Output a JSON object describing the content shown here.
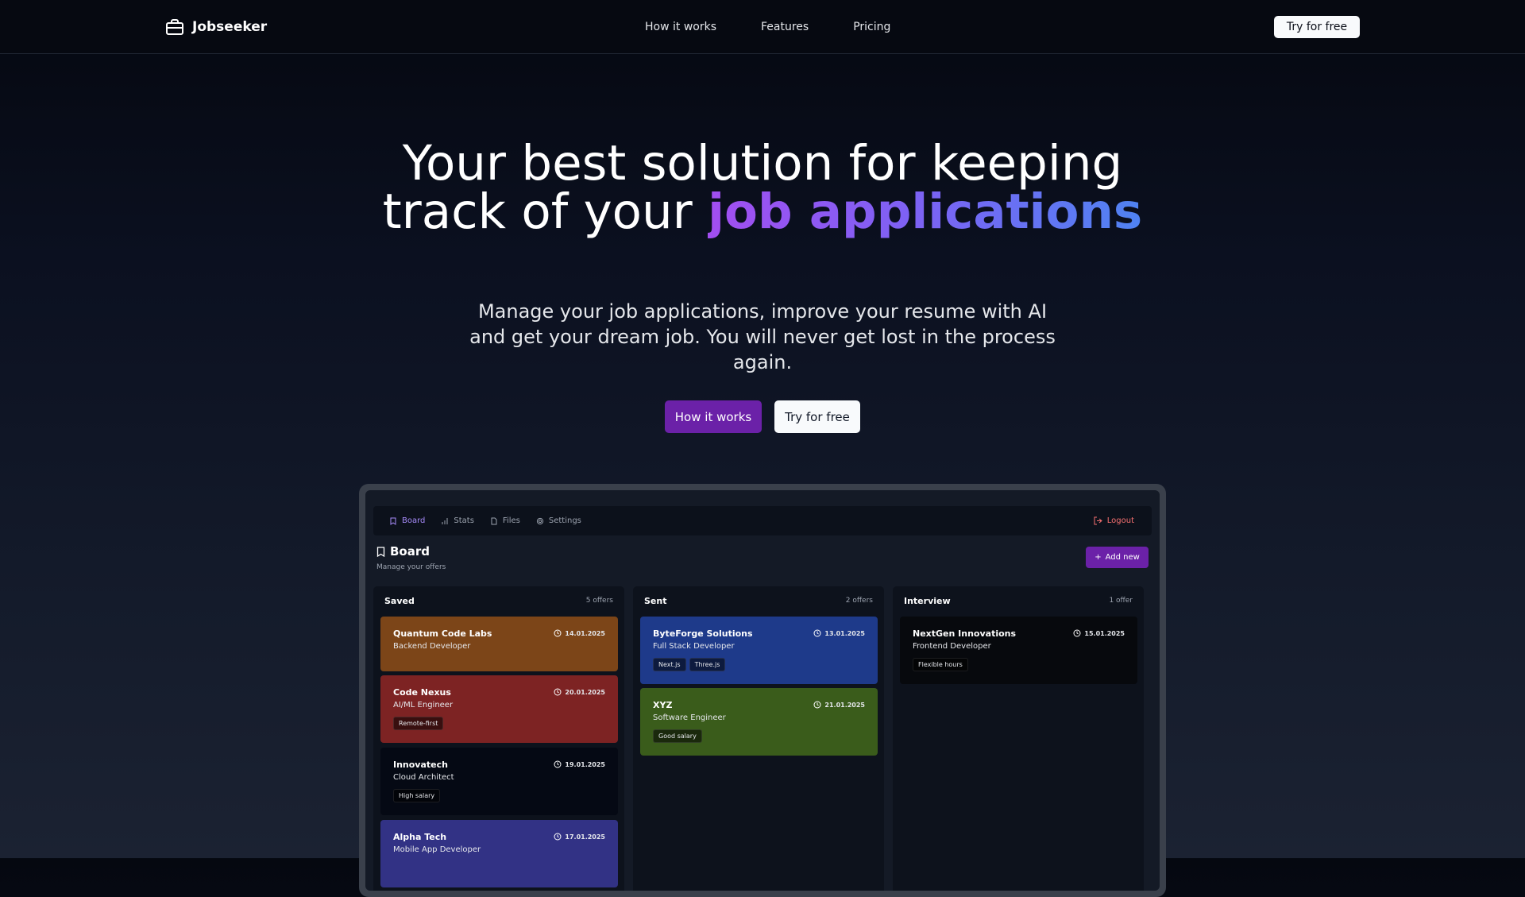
{
  "nav": {
    "brand": "Jobseeker",
    "links": [
      "How it works",
      "Features",
      "Pricing"
    ],
    "cta": "Try for free"
  },
  "hero": {
    "title_plain": "Your best solution for keeping track of your",
    "title_highlight": "job applications",
    "subtitle": "Manage your job applications, improve your resume with AI and get your dream job. You will never get lost in the process again.",
    "primary_button": "How it works",
    "secondary_button": "Try for free"
  },
  "app": {
    "tabs": [
      "Board",
      "Stats",
      "Files",
      "Settings"
    ],
    "active_tab": "Board",
    "logout": "Logout",
    "board_title": "Board",
    "board_subtitle": "Manage your offers",
    "add_new": "Add new",
    "columns": [
      {
        "title": "Saved",
        "count": "5 offers",
        "cards": [
          {
            "company": "Quantum Code Labs",
            "role": "Backend Developer",
            "date": "14.01.2025",
            "tags": [],
            "color": "#7c4518"
          },
          {
            "company": "Code Nexus",
            "role": "AI/ML Engineer",
            "date": "20.01.2025",
            "tags": [
              "Remote-first"
            ],
            "color": "#7d2323"
          },
          {
            "company": "Innovatech",
            "role": "Cloud Architect",
            "date": "19.01.2025",
            "tags": [
              "High salary"
            ],
            "color": "#050914"
          },
          {
            "company": "Alpha Tech",
            "role": "Mobile App Developer",
            "date": "17.01.2025",
            "tags": [],
            "color": "#323285"
          }
        ]
      },
      {
        "title": "Sent",
        "count": "2 offers",
        "cards": [
          {
            "company": "ByteForge Solutions",
            "role": "Full Stack Developer",
            "date": "13.01.2025",
            "tags": [
              "Next.js",
              "Three.js"
            ],
            "color": "#1e3a8a"
          },
          {
            "company": "XYZ",
            "role": "Software Engineer",
            "date": "21.01.2025",
            "tags": [
              "Good salary"
            ],
            "color": "#3a5c1b"
          }
        ]
      },
      {
        "title": "Interview",
        "count": "1 offer",
        "cards": [
          {
            "company": "NextGen Innovations",
            "role": "Frontend Developer",
            "date": "15.01.2025",
            "tags": [
              "Flexible hours"
            ],
            "color": "#07090d"
          }
        ]
      }
    ]
  }
}
